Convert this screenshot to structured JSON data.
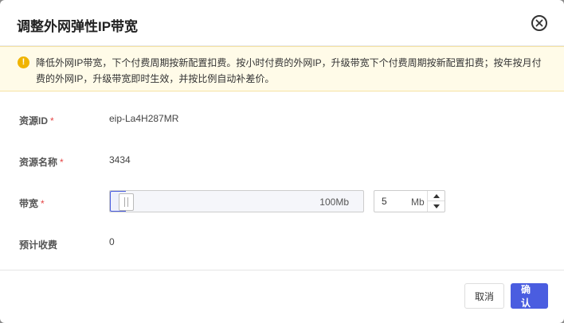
{
  "dialog": {
    "title": "调整外网弹性IP带宽",
    "close_icon": "close-circle-icon"
  },
  "notice": {
    "icon": "warning-icon",
    "icon_glyph": "!",
    "text": "降低外网IP带宽，下个付费周期按新配置扣费。按小时付费的外网IP，升级带宽下个付费周期按新配置扣费；按年按月付费的外网IP，升级带宽即时生效，并按比例自动补差价。"
  },
  "form": {
    "required_mark": "*",
    "resource_id": {
      "label": "资源ID",
      "value": "eip-La4H287MR"
    },
    "resource_name": {
      "label": "资源名称",
      "value": "3434"
    },
    "bandwidth": {
      "label": "带宽",
      "slider_max_label": "100Mb",
      "slider_level": 0.05,
      "input_value": "5",
      "unit": "Mb"
    },
    "estimated_fee": {
      "label": "预计收费",
      "value": "0"
    }
  },
  "footer": {
    "cancel_label": "取消",
    "confirm_label": "确认"
  },
  "colors": {
    "accent": "#4a5de0",
    "required": "#e54545",
    "notice_bg": "#fffbe8",
    "notice_icon": "#f0b400"
  }
}
